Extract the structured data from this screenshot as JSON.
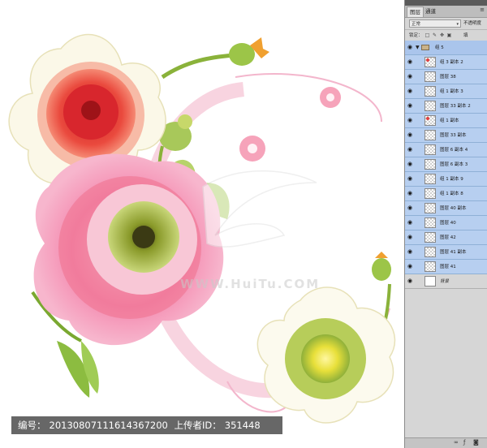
{
  "watermark": {
    "site_text": "WWW.HuiTu.COM"
  },
  "caption": {
    "id_label": "编号：",
    "id_value": "20130807111614367200",
    "uploader_label": "上传者ID：",
    "uploader_value": "351448"
  },
  "colors": {
    "selected_layer": "#b7cff0",
    "panel_bg": "#d6d6d6",
    "caption_bg": "#3c3c3c",
    "peony_pink": "#f07aa0",
    "chrysanthemum_red": "#e8393a"
  },
  "panel": {
    "tabs": [
      {
        "label": "图层"
      },
      {
        "label": "通道"
      }
    ],
    "menu_icon": "panel-menu-icon",
    "blend_mode": "正常",
    "opacity_label": "不透明度",
    "lock_label": "锁定：",
    "fill_label": "填",
    "layers": [
      {
        "name": "组 5",
        "type": "group"
      },
      {
        "name": "组 3 副本 2",
        "type": "layer",
        "thumb": "red-dot"
      },
      {
        "name": "图层 38",
        "type": "layer"
      },
      {
        "name": "组 1 副本 3",
        "type": "layer"
      },
      {
        "name": "图层 33 副本 2",
        "type": "layer"
      },
      {
        "name": "组 1 副本",
        "type": "layer",
        "thumb": "red-dot"
      },
      {
        "name": "图层 33 副本",
        "type": "layer"
      },
      {
        "name": "图层 6 副本 4",
        "type": "layer"
      },
      {
        "name": "图层 6 副本 3",
        "type": "layer"
      },
      {
        "name": "组 1 副本 9",
        "type": "layer"
      },
      {
        "name": "组 1 副本 8",
        "type": "layer"
      },
      {
        "name": "图层 40 副本",
        "type": "layer"
      },
      {
        "name": "图层 40",
        "type": "layer"
      },
      {
        "name": "图层 42",
        "type": "layer"
      },
      {
        "name": "图层 41 副本",
        "type": "layer"
      },
      {
        "name": "图层 41",
        "type": "layer"
      },
      {
        "name": "背景",
        "type": "base"
      }
    ]
  }
}
